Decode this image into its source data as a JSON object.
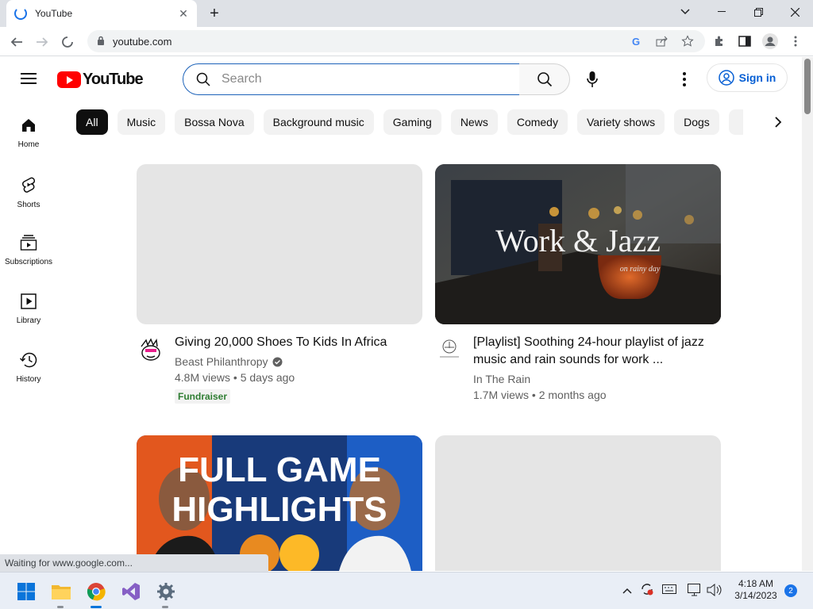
{
  "browser": {
    "tab_title": "YouTube",
    "url": "youtube.com",
    "status_text": "Waiting for www.google.com..."
  },
  "youtube": {
    "logo_text": "YouTube",
    "search_placeholder": "Search",
    "sign_in_label": "Sign in",
    "chips": [
      "All",
      "Music",
      "Bossa Nova",
      "Background music",
      "Gaming",
      "News",
      "Comedy",
      "Variety shows",
      "Dogs"
    ],
    "nav": [
      {
        "label": "Home",
        "icon": "home-icon"
      },
      {
        "label": "Shorts",
        "icon": "shorts-icon"
      },
      {
        "label": "Subscriptions",
        "icon": "subscriptions-icon"
      },
      {
        "label": "Library",
        "icon": "library-icon"
      },
      {
        "label": "History",
        "icon": "history-icon"
      }
    ],
    "videos": [
      {
        "title": "Giving 20,000 Shoes To Kids In Africa",
        "channel": "Beast Philanthropy",
        "verified": true,
        "stats": "4.8M views • 5 days ago",
        "badge": "Fundraiser"
      },
      {
        "title": "[Playlist] Soothing 24-hour playlist of jazz music and rain sounds for work ...",
        "channel": "In The Rain",
        "stats": "1.7M views • 2 months ago",
        "thumb_text": "Work & Jazz",
        "thumb_subtext": "on rainy day"
      },
      {
        "thumb_text_line1": "FULL GAME",
        "thumb_text_line2": "HIGHLIGHTS"
      },
      {}
    ]
  },
  "taskbar": {
    "time": "4:18 AM",
    "date": "3/14/2023",
    "notification_count": "2"
  },
  "colors": {
    "youtube_red": "#ff0000",
    "link_blue": "#065fd4",
    "fundraiser_green": "#2e7d32"
  }
}
